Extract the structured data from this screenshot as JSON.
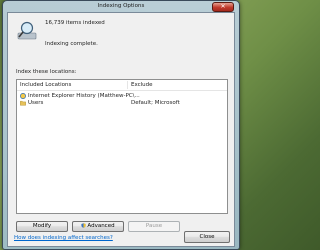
{
  "window": {
    "title": "Indexing Options"
  },
  "header": {
    "items_indexed": "16,739 items indexed",
    "status": "Indexing complete."
  },
  "section": {
    "label": "Index these locations:"
  },
  "table": {
    "columns": [
      "Included Locations",
      "Exclude"
    ],
    "rows": [
      {
        "location": "Internet Explorer History (Matthew-PC\\...",
        "exclude": "",
        "icon": "ie-history-icon"
      },
      {
        "location": "Users",
        "exclude": "Default; Microsoft",
        "icon": "folder-icon"
      }
    ]
  },
  "buttons": {
    "modify": "Modify",
    "advanced": "Advanced",
    "pause": "Pause",
    "close": "Close"
  },
  "links": {
    "help": "How does indexing affect searches?"
  },
  "colors": {
    "link": "#0066cc",
    "close_button": "#c0392b"
  }
}
